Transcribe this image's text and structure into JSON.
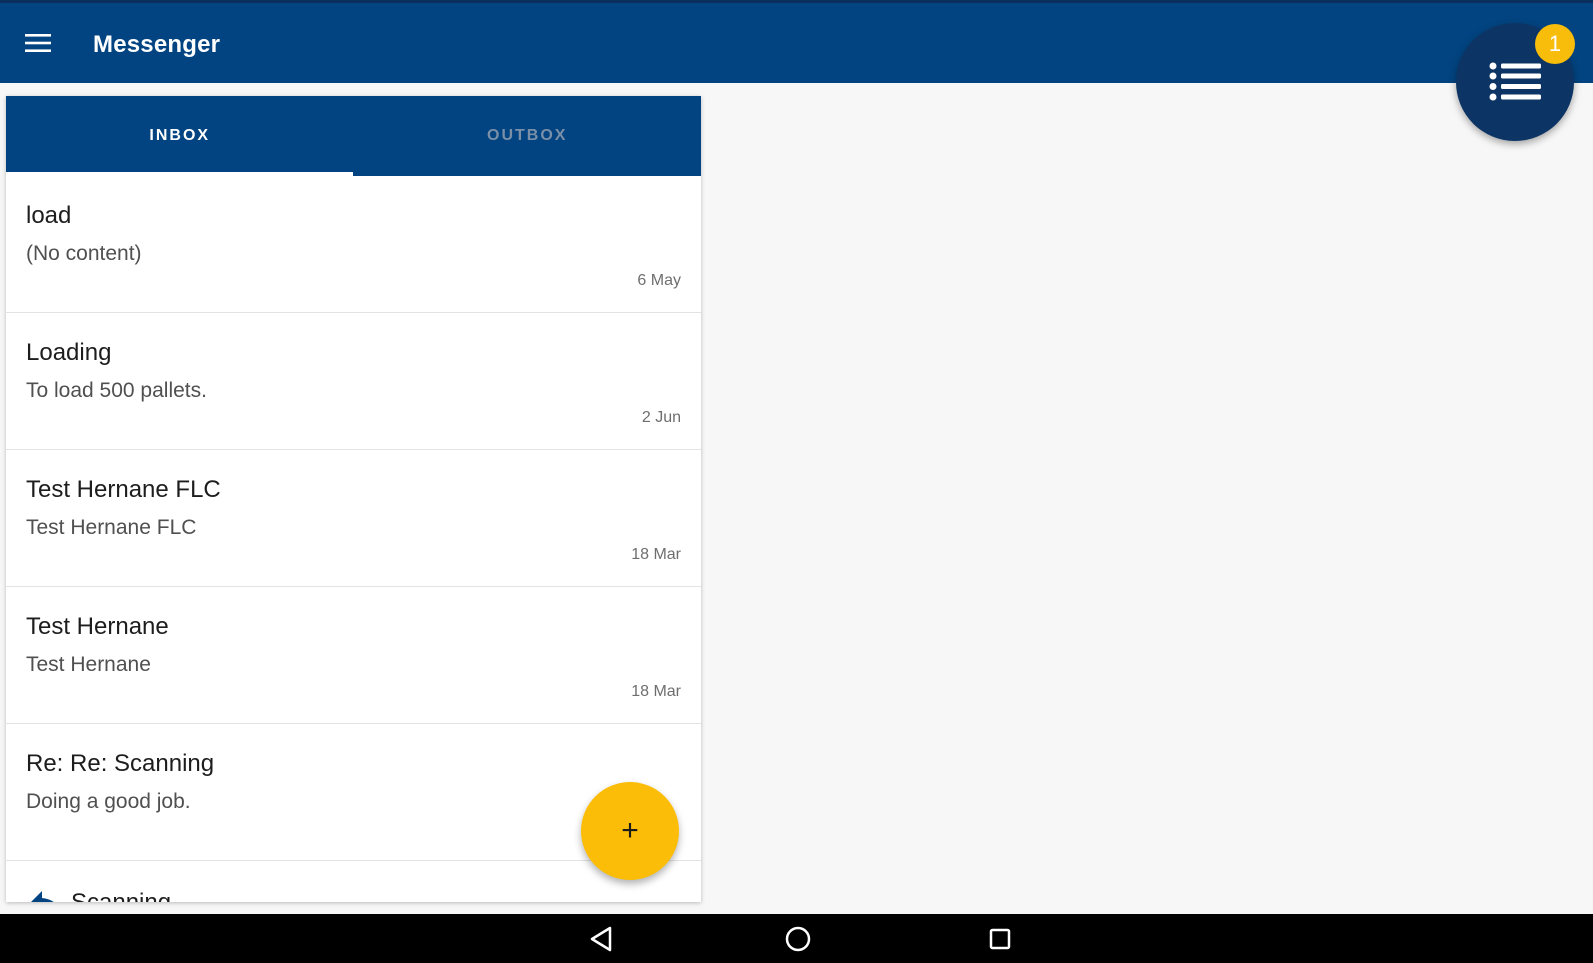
{
  "app": {
    "title": "Messenger",
    "accent_color": "#024481",
    "fab_color": "#fbbd08"
  },
  "header": {
    "menu_icon": "hamburger-menu-icon",
    "tasks_icon": "list-icon",
    "tasks_badge": "1"
  },
  "tabs": [
    {
      "label": "INBOX",
      "selected": true
    },
    {
      "label": "OUTBOX",
      "selected": false
    }
  ],
  "messages": [
    {
      "subject": "load",
      "preview": "(No content)",
      "date": "6 May"
    },
    {
      "subject": "Loading",
      "preview": "To load 500 pallets.",
      "date": "2 Jun"
    },
    {
      "subject": "Test Hernane FLC",
      "preview": "Test Hernane FLC",
      "date": "18 Mar"
    },
    {
      "subject": "Test Hernane",
      "preview": "Test Hernane",
      "date": "18 Mar"
    },
    {
      "subject": "Re: Re: Scanning",
      "preview": "Doing a good job.",
      "date": ""
    }
  ],
  "partial_message": {
    "subject": "Scanning",
    "icon": "reply-icon"
  },
  "compose_fab": {
    "label": "+",
    "icon": "plus-icon"
  },
  "system_nav": {
    "back": "back-icon",
    "home": "home-icon",
    "recents": "recents-icon"
  }
}
